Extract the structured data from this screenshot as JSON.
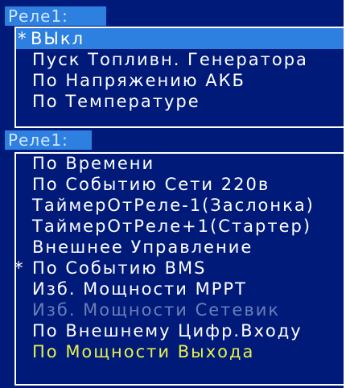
{
  "screen": {
    "colors": {
      "background": "#001a7a",
      "highlight": "#2d7fe0",
      "text": "#ffffff",
      "disabled_text": "#6b7fb8",
      "active_text": "#e8f04a"
    }
  },
  "menu1": {
    "header": "Реле1:",
    "items": [
      {
        "mark": "*",
        "label": "ВЫкл"
      },
      {
        "mark": "",
        "label": "Пуск Топливн. Генератора"
      },
      {
        "mark": "",
        "label": "По Напряжению АКБ"
      },
      {
        "mark": "",
        "label": "По Температуре"
      }
    ]
  },
  "menu2": {
    "header": "Реле1:",
    "items": [
      {
        "mark": "",
        "label": "По Времени"
      },
      {
        "mark": "",
        "label": "По Событию Сети 220в"
      },
      {
        "mark": "",
        "label": "ТаймерОтРеле-1(Заслонка)"
      },
      {
        "mark": "",
        "label": "ТаймерОтРеле+1(Стартер)"
      },
      {
        "mark": "",
        "label": "Внешнее Управление"
      },
      {
        "mark": "*",
        "label": "По Событию BMS"
      },
      {
        "mark": "",
        "label": "Изб. Мощности МРРТ"
      },
      {
        "mark": "",
        "label": "Изб. Мощности Сетевик"
      },
      {
        "mark": "",
        "label": "По Внешнему Цифр.Входу"
      },
      {
        "mark": "",
        "label": "По Мощности Выхода"
      }
    ]
  }
}
